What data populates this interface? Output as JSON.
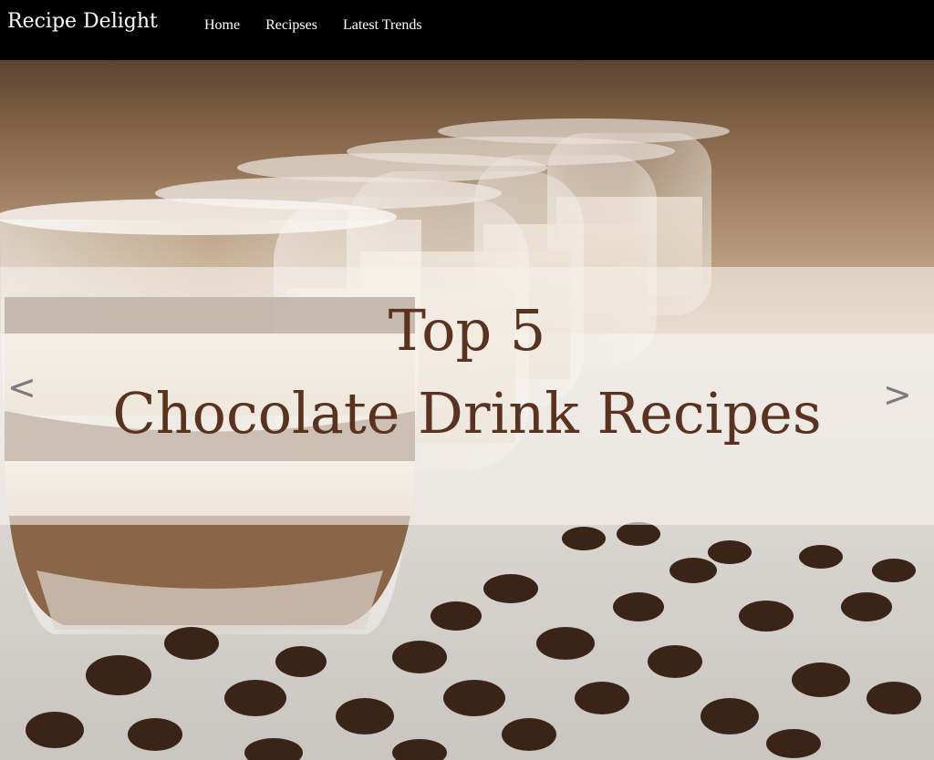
{
  "navbar": {
    "brand": "Recipe Delight",
    "links": [
      {
        "label": "Home"
      },
      {
        "label": "Recipses"
      },
      {
        "label": "Latest Trends"
      }
    ]
  },
  "carousel": {
    "caption_line1": "Top 5",
    "caption_line2": "Chocolate Drink Recipes",
    "prev_arrow": "<",
    "next_arrow": ">",
    "image_subject": "glasses of layered chocolate dessert drink with coffee beans"
  },
  "colors": {
    "nav_background": "#000000",
    "nav_text": "#ffffff",
    "caption_text": "#5a3320",
    "arrow": "#7d7a80"
  }
}
